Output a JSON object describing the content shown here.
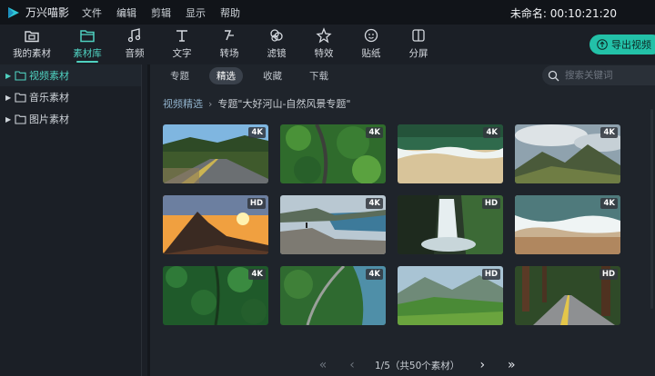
{
  "app": {
    "name": "万兴喵影",
    "menu": [
      "文件",
      "编辑",
      "剪辑",
      "显示",
      "帮助"
    ],
    "project": "未命名: 00:10:21:20"
  },
  "toolbar": {
    "items": [
      {
        "label": "我的素材",
        "icon": "folder-film-icon"
      },
      {
        "label": "素材库",
        "icon": "folder-icon"
      },
      {
        "label": "音频",
        "icon": "music-note-icon"
      },
      {
        "label": "文字",
        "icon": "text-icon"
      },
      {
        "label": "转场",
        "icon": "transition-icon"
      },
      {
        "label": "滤镜",
        "icon": "filter-icon"
      },
      {
        "label": "特效",
        "icon": "effects-star-icon"
      },
      {
        "label": "贴纸",
        "icon": "sticker-face-icon"
      },
      {
        "label": "分屏",
        "icon": "split-screen-icon"
      }
    ],
    "active_index": 1,
    "export_label": "导出视频"
  },
  "sidebar": {
    "folders": [
      {
        "label": "视频素材",
        "active": true
      },
      {
        "label": "音乐素材",
        "active": false
      },
      {
        "label": "图片素材",
        "active": false
      }
    ]
  },
  "subtabs": {
    "items": [
      "专题",
      "精选",
      "收藏",
      "下载"
    ],
    "active_index": 1
  },
  "search": {
    "placeholder": "搜索关键词"
  },
  "breadcrumb": {
    "root": "视频精选",
    "current": "专题\"大好河山-自然风景专题\""
  },
  "thumbnails": [
    {
      "badge": "4K",
      "scene": "road-desert"
    },
    {
      "badge": "4K",
      "scene": "forest-aerial-road"
    },
    {
      "badge": "4K",
      "scene": "beach-waves"
    },
    {
      "badge": "4K",
      "scene": "mountain-clouds"
    },
    {
      "badge": "HD",
      "scene": "sunset-peak"
    },
    {
      "badge": "4K",
      "scene": "fjord-cliff"
    },
    {
      "badge": "HD",
      "scene": "waterfall"
    },
    {
      "badge": "4K",
      "scene": "shore-surf"
    },
    {
      "badge": "4K",
      "scene": "forest-canopy"
    },
    {
      "badge": "4K",
      "scene": "river-valley"
    },
    {
      "badge": "HD",
      "scene": "green-valley"
    },
    {
      "badge": "HD",
      "scene": "redwood-road"
    }
  ],
  "pagination": {
    "text": "1/5（共50个素材）",
    "first_icon": "double-chevron-left-icon",
    "prev_icon": "chevron-left-icon",
    "next_icon": "chevron-right-icon",
    "last_icon": "double-chevron-right-icon"
  },
  "colors": {
    "accent": "#4fd1c0",
    "export": "#23c1a8"
  }
}
